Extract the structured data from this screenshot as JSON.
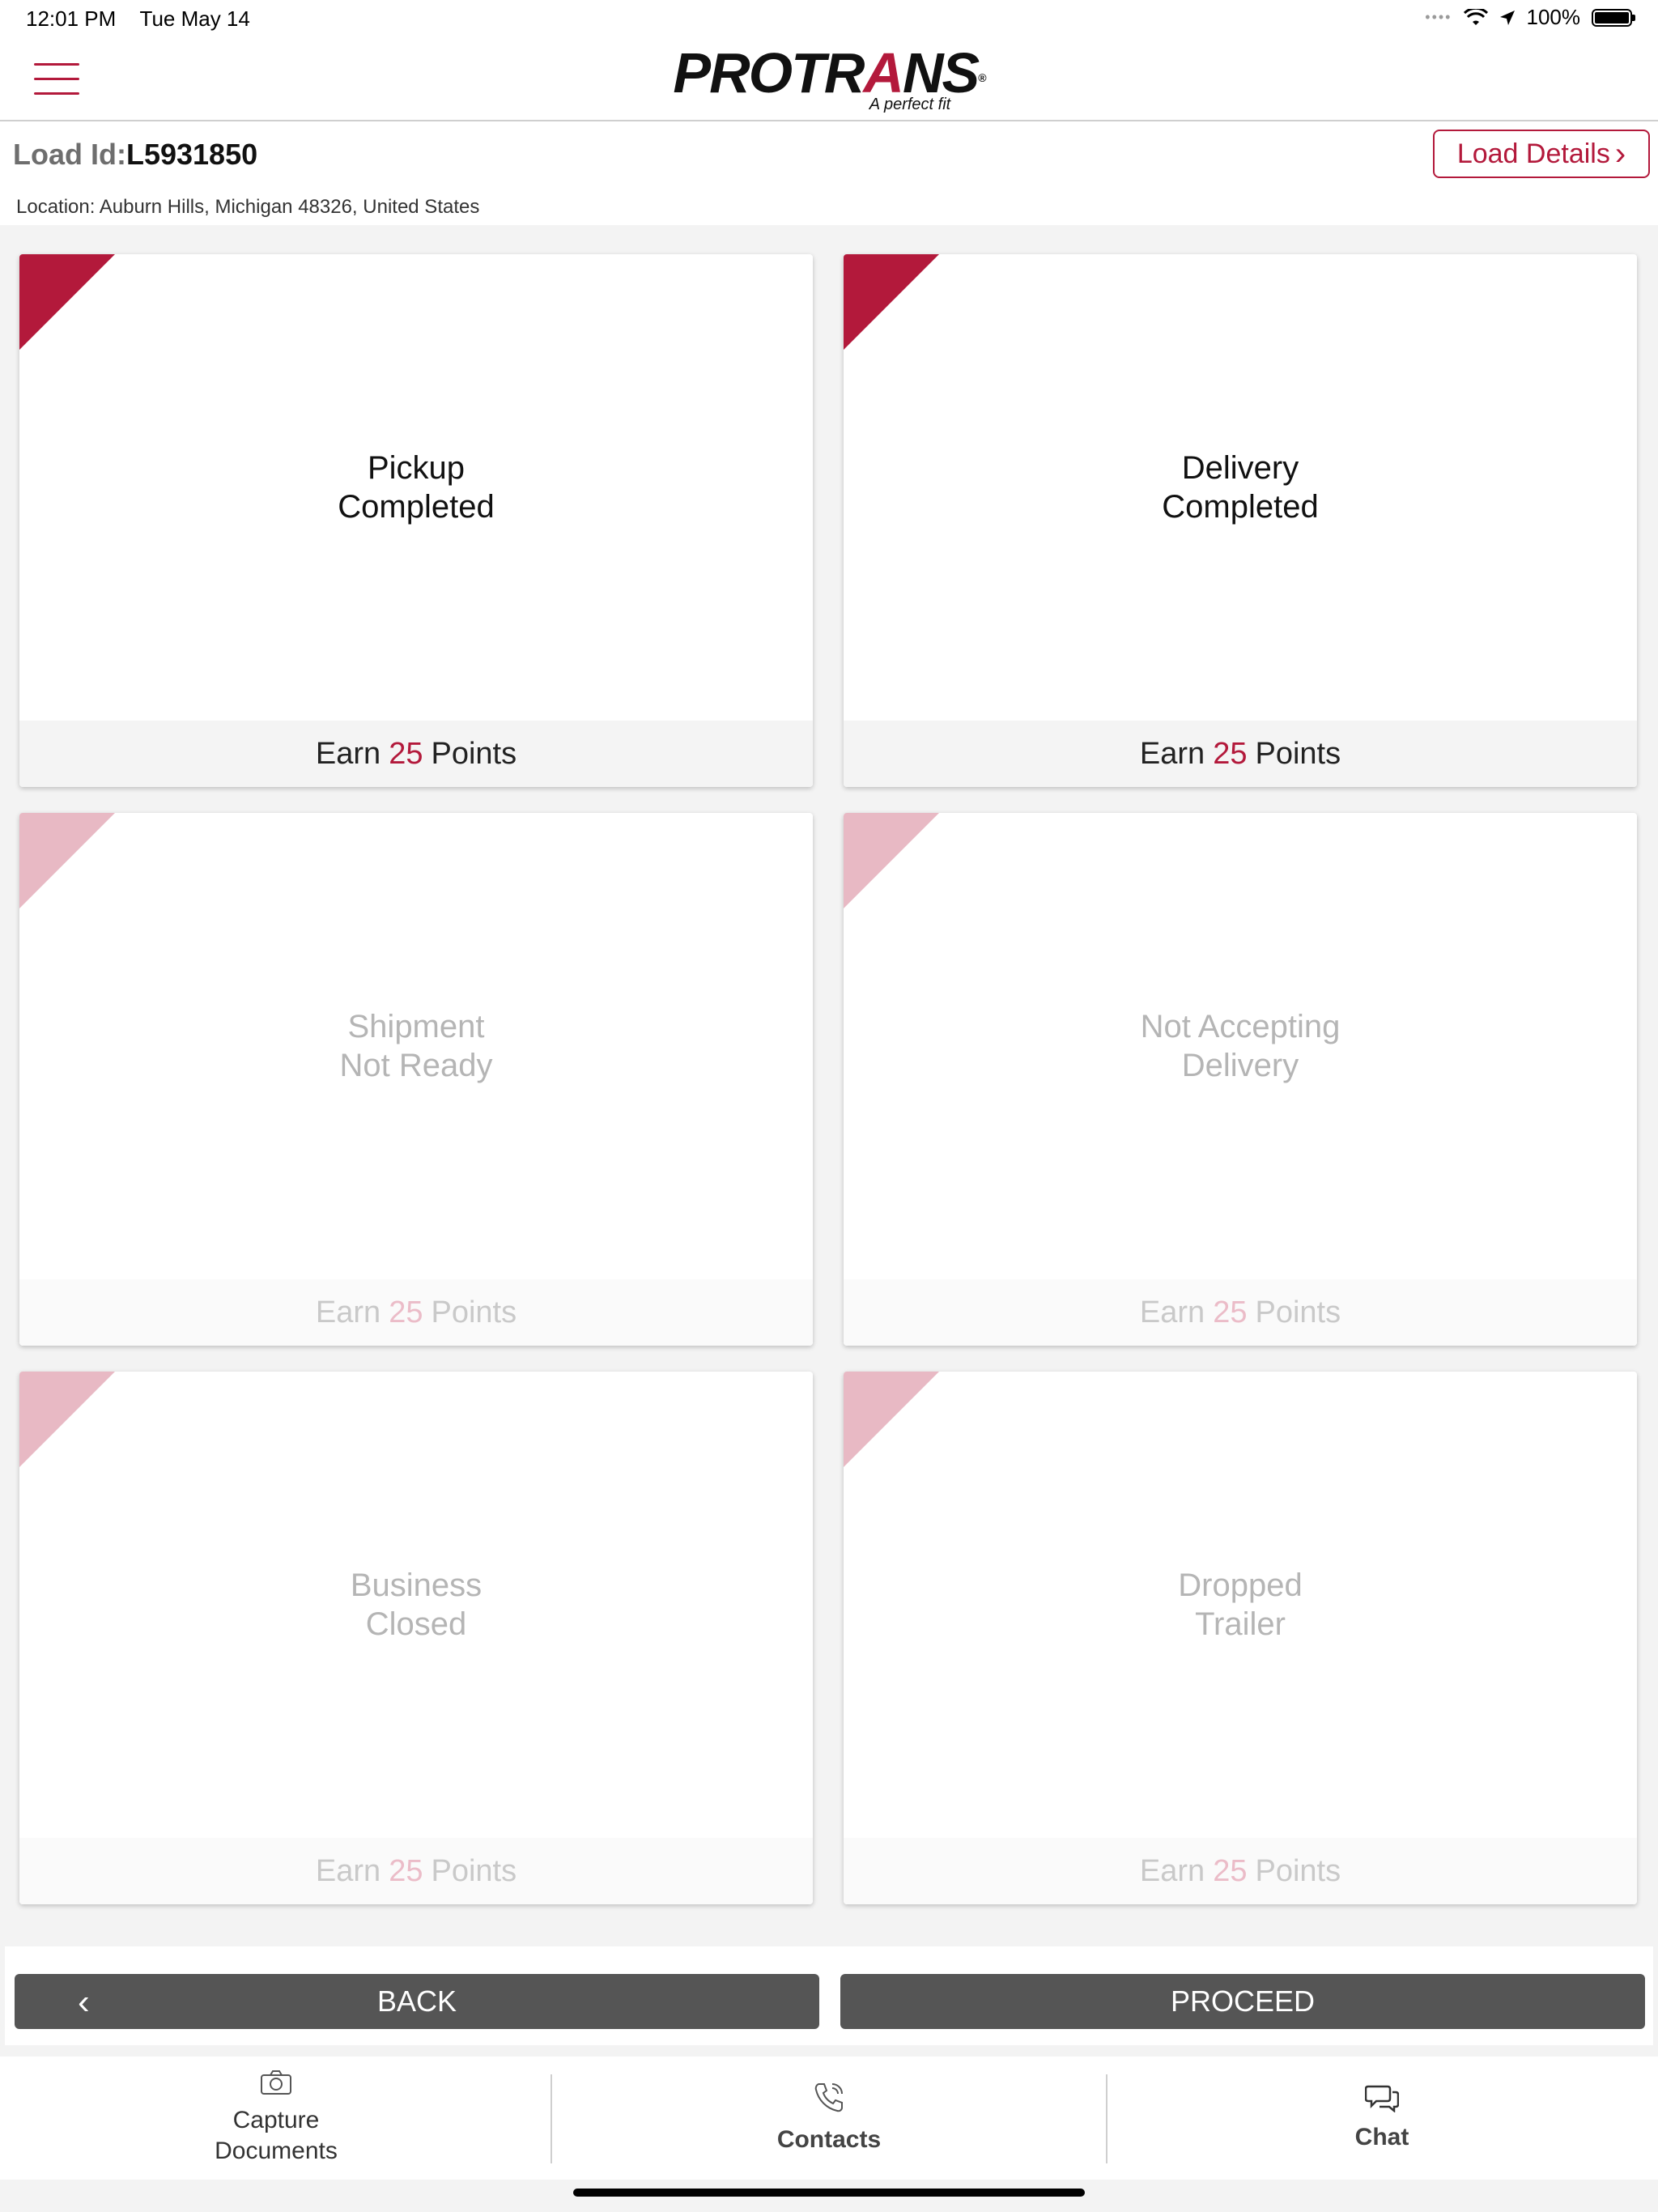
{
  "status_bar": {
    "time": "12:01 PM",
    "date": "Tue May 14",
    "battery": "100%"
  },
  "brand": {
    "name_pre": "PROTR",
    "name_a": "A",
    "name_post": "NS",
    "registered": "®",
    "tagline": "A perfect fit"
  },
  "load": {
    "id_label": "Load Id:",
    "id_value": "L5931850",
    "location": "Location: Auburn Hills, Michigan 48326, United States",
    "details_label": "Load Details",
    "details_chevron": "›"
  },
  "tiles": [
    {
      "line1": "Pickup",
      "line2": "Completed",
      "earn": "Earn",
      "points": "25",
      "points_label": "Points"
    },
    {
      "line1": "Delivery",
      "line2": "Completed",
      "earn": "Earn",
      "points": "25",
      "points_label": "Points"
    },
    {
      "line1": "Shipment",
      "line2": "Not Ready",
      "earn": "Earn",
      "points": "25",
      "points_label": "Points"
    },
    {
      "line1": "Not Accepting",
      "line2": "Delivery",
      "earn": "Earn",
      "points": "25",
      "points_label": "Points"
    },
    {
      "line1": "Business",
      "line2": "Closed",
      "earn": "Earn",
      "points": "25",
      "points_label": "Points"
    },
    {
      "line1": "Dropped",
      "line2": "Trailer",
      "earn": "Earn",
      "points": "25",
      "points_label": "Points"
    }
  ],
  "actions": {
    "back_label": "BACK",
    "back_chevron": "‹",
    "proceed_label": "PROCEED"
  },
  "tabs": {
    "capture_line1": "Capture",
    "capture_line2": "Documents",
    "contacts": "Contacts",
    "chat": "Chat"
  },
  "colors": {
    "accent": "#b3193b",
    "accent_light": "#e8b9c4",
    "button": "#555555"
  }
}
